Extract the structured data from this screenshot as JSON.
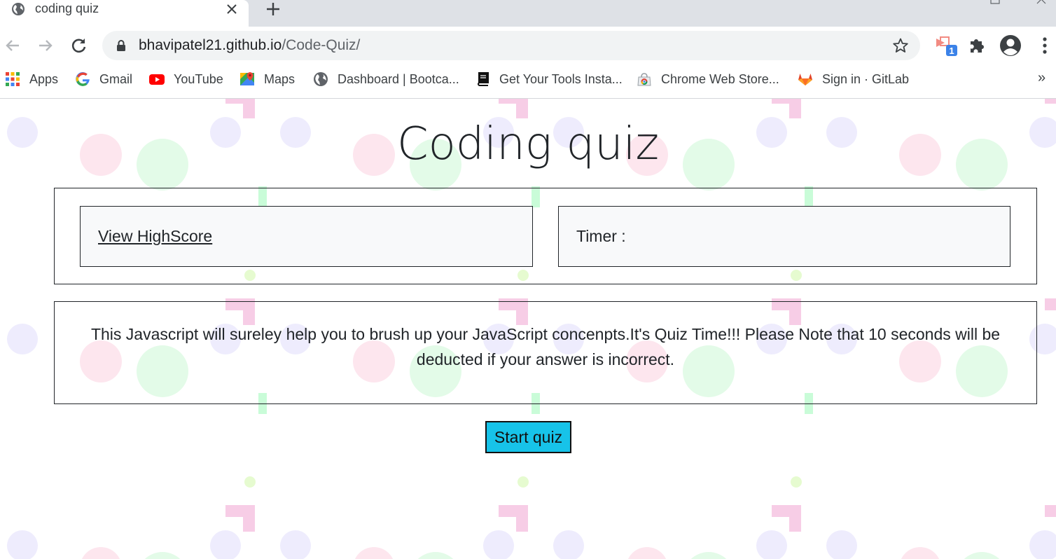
{
  "browser": {
    "tab": {
      "title": "coding quiz",
      "favicon": "globe-icon"
    },
    "url": {
      "host": "bhavipatel21.github.io",
      "path": "/Code-Quiz/"
    },
    "extension_badge": "1",
    "bookmarks": [
      {
        "label": "Apps",
        "icon": "apps-grid-icon"
      },
      {
        "label": "Gmail",
        "icon": "google-icon"
      },
      {
        "label": "YouTube",
        "icon": "youtube-icon"
      },
      {
        "label": "Maps",
        "icon": "maps-icon"
      },
      {
        "label": "Dashboard | Bootca...",
        "icon": "globe-icon"
      },
      {
        "label": "Get Your Tools Insta...",
        "icon": "book-icon"
      },
      {
        "label": "Chrome Web Store...",
        "icon": "chrome-web-store-icon"
      },
      {
        "label": "Sign in · GitLab",
        "icon": "gitlab-icon"
      }
    ],
    "more_bookmarks": "»"
  },
  "page": {
    "title": "Coding quiz",
    "highscore_link": "View HighScore",
    "timer_label": "Timer :",
    "intro": "This Javascript will sureley help you to brush up your JavaScript concenpts.It's Quiz Time!!! Please Note that 10 seconds will be deducted if your answer is incorrect.",
    "start_button": "Start quiz"
  },
  "colors": {
    "start_button_bg": "#17c3e9",
    "card_bg": "#f8f9fa",
    "text": "#212529"
  }
}
